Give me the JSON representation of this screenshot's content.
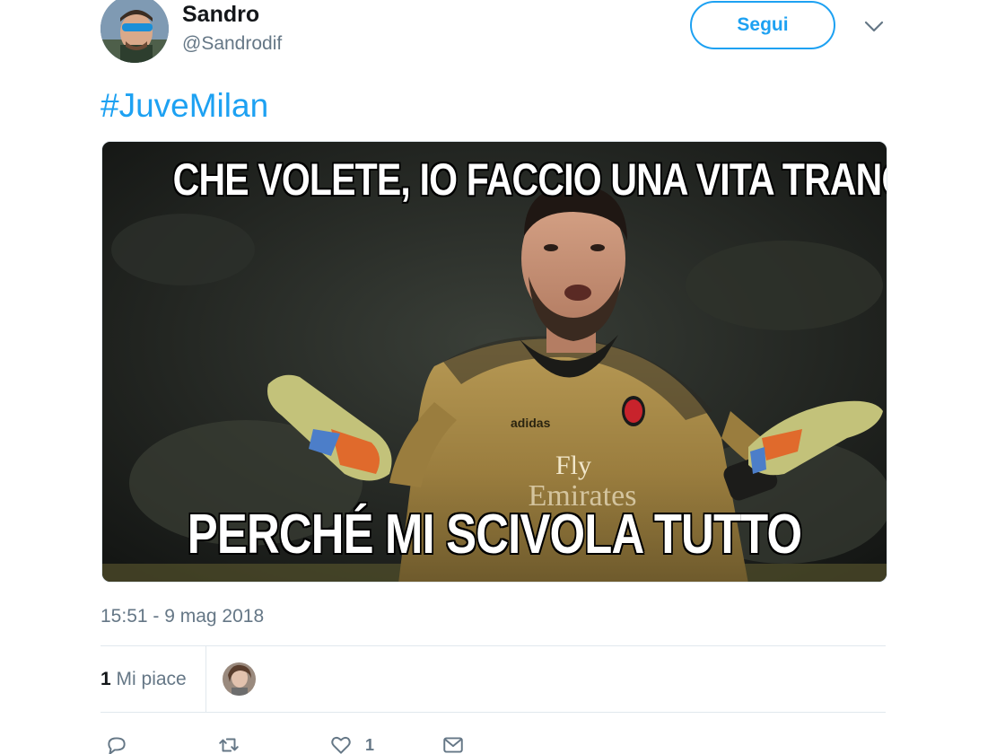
{
  "author": {
    "display_name": "Sandro",
    "handle": "@Sandrodif"
  },
  "follow_button_label": "Segui",
  "tweet": {
    "hashtag": "#JuveMilan",
    "media": {
      "top_caption": "CHE VOLETE, IO FACCIO UNA VITA TRANQUILLA",
      "bottom_caption": "PERCHÉ MI SCIVOLA TUTTO",
      "jersey_text_1": "Fly",
      "jersey_text_2": "Emirates",
      "jersey_brand": "adidas"
    },
    "timestamp": "15:51 - 9 mag 2018"
  },
  "stats": {
    "likes_count": "1",
    "likes_label": "Mi piace"
  },
  "actions": {
    "like_count": "1"
  },
  "colors": {
    "accent": "#1da1f2",
    "secondary_text": "#657786",
    "divider": "#e1e8ed"
  },
  "icons": {
    "more": "chevron-down-icon",
    "reply": "reply-icon",
    "retweet": "retweet-icon",
    "like": "heart-icon",
    "dm": "envelope-icon"
  }
}
